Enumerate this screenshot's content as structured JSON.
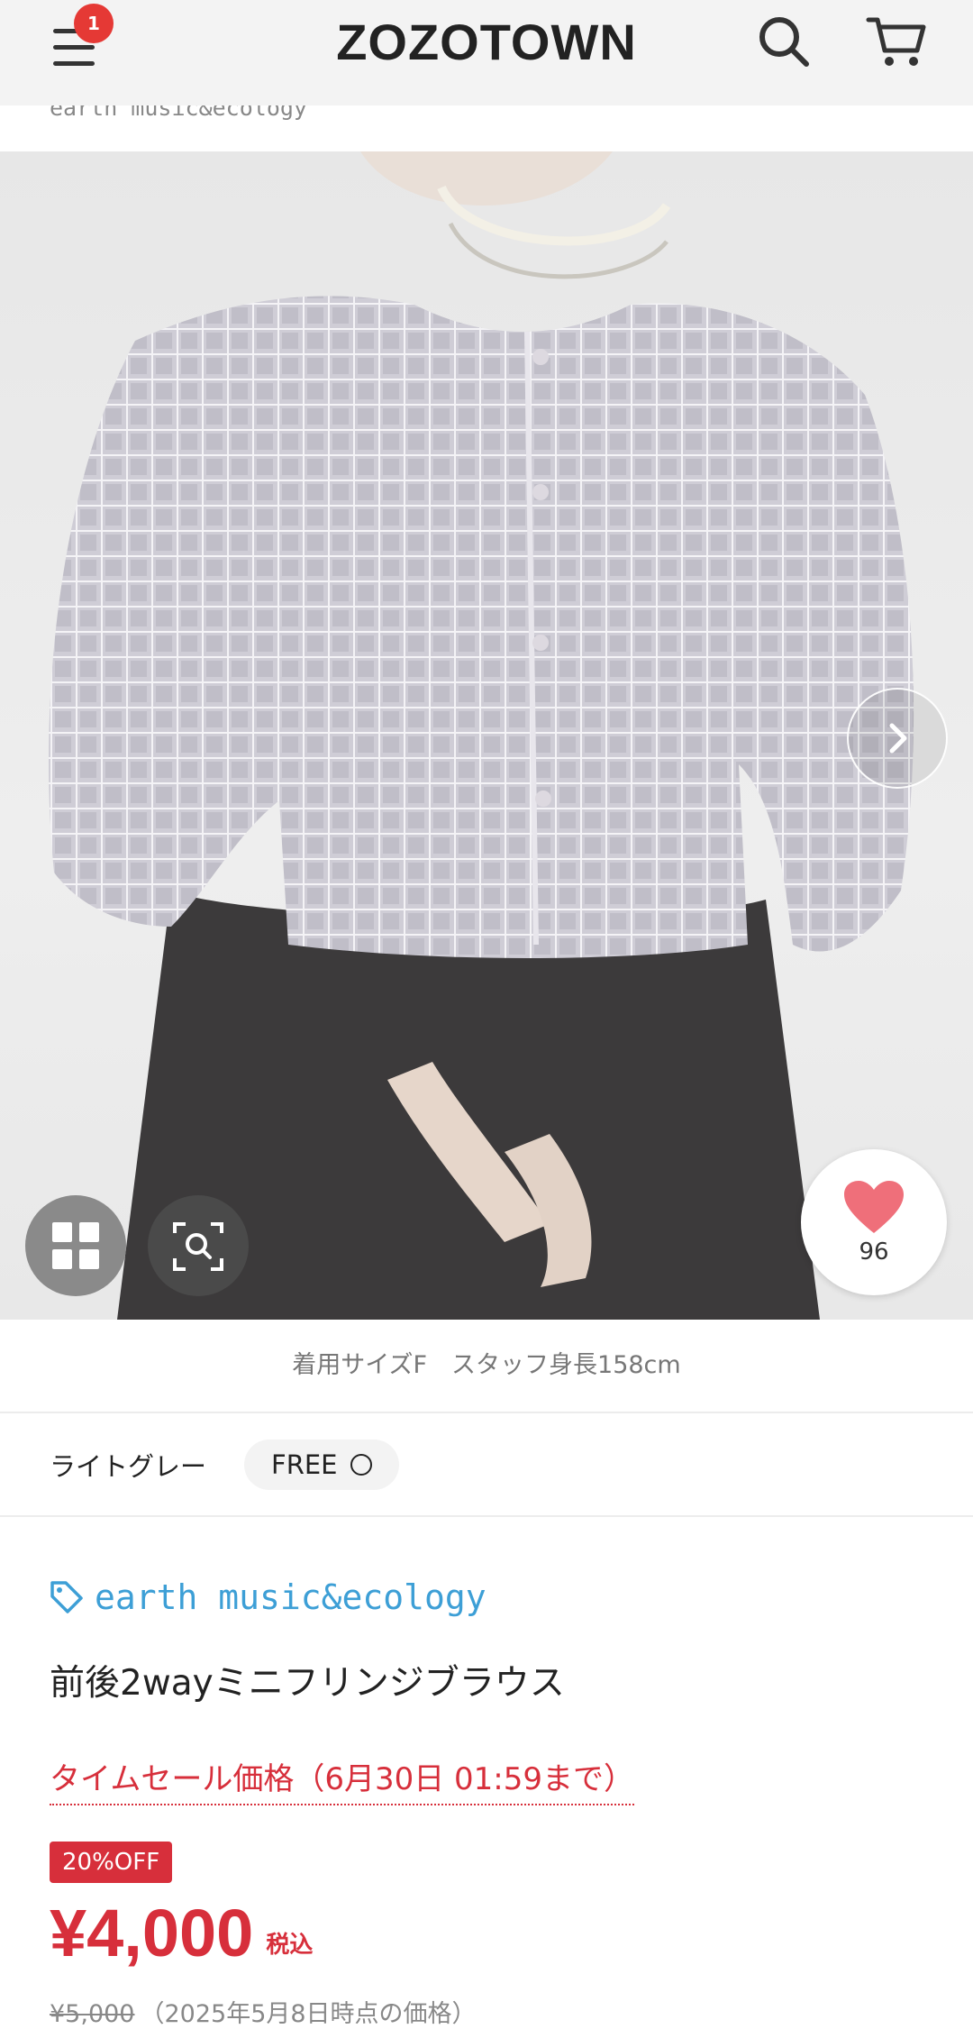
{
  "header": {
    "logo": "ZOZOTOWN",
    "menu_badge": "1",
    "icons": {
      "menu": "hamburger-menu-icon",
      "search": "search-icon",
      "cart": "cart-icon"
    }
  },
  "brand_strip": {
    "text": "earth music&ecology"
  },
  "gallery": {
    "caption": "着用サイズF　スタッフ身長158cm",
    "favorite_count": "96",
    "icons": {
      "next": "chevron-right-icon",
      "grid": "grid-view-icon",
      "zoom": "image-search-icon",
      "favorite": "heart-icon"
    }
  },
  "variant": {
    "color": "ライトグレー",
    "size": "FREE",
    "availability_symbol": "○"
  },
  "product": {
    "brand": "earth music&ecology",
    "title": "前後2wayミニフリンジブラウス",
    "sale_label": "タイムセール価格（6月30日 01:59まで）",
    "discount": "20%OFF",
    "price": "¥4,000",
    "tax_label": "税込",
    "original_price": "¥5,000",
    "original_note": "（2025年5月8日時点の価格）"
  },
  "colors": {
    "accent_red": "#d72f3b",
    "brand_blue": "#3d9fd6",
    "badge_red": "#e53935",
    "heart_pink": "#ef6f7a"
  }
}
